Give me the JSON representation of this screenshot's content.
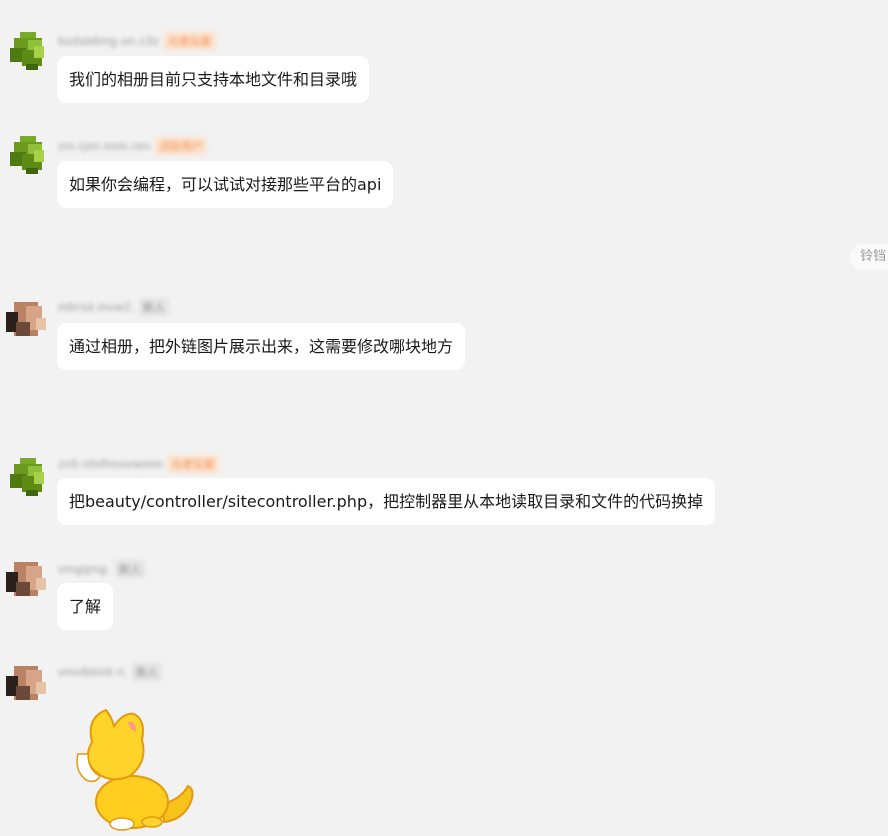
{
  "messages": [
    {
      "nick": "bsdsb6mg.on.c3z",
      "tag": "元老玩家",
      "text": "我们的相册目前只支持本地文件和目录哦"
    },
    {
      "nick": "zm.rjxn.nsm.ren",
      "tag": "活跃用户",
      "text": "如果你会编程，可以试试对接那些平台的api"
    },
    {
      "nick": "mbrsd.mvw2.",
      "tag": "新人",
      "text": "通过相册，把外链图片展示出来，这需要修改哪块地方"
    },
    {
      "nick": "zn5.nfsRmxvwmm",
      "tag": "元老玩家",
      "text": "把beauty/controller/sitecontroller.php，把控制器里从本地读取目录和文件的代码换掉"
    },
    {
      "nick": "vmgqmg.",
      "tag": "新人",
      "text": "了解"
    },
    {
      "nick": "vmx8dsl4.ri.",
      "tag": "新人",
      "sticker": "yellow-cat-sticker"
    }
  ],
  "side_tag": "铃铛"
}
